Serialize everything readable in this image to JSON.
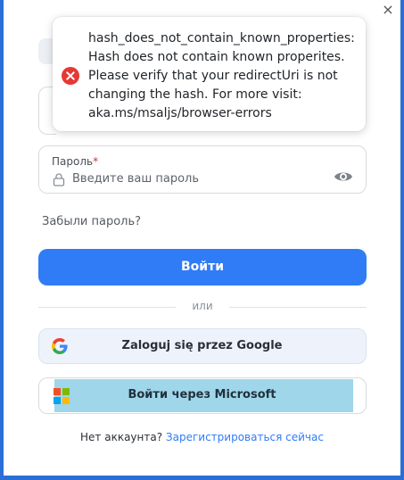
{
  "dialog": {
    "close_glyph": "×"
  },
  "toast": {
    "type": "error",
    "icon": "error-circle-icon",
    "message": "hash_does_not_contain_known_properties: Hash does not contain known properites. Please verify that your redirectUri is not changing the hash. For more visit: aka.ms/msaljs/browser-errors"
  },
  "password": {
    "label": "Пароль",
    "required_mark": "*",
    "placeholder": "Введите ваш пароль",
    "value": ""
  },
  "forgot_password": "Забыли пароль?",
  "login_button": "Войти",
  "divider": "или",
  "google_button": "Zaloguj się przez Google",
  "microsoft_button": "Войти через Microsoft",
  "signup": {
    "prompt": "Нет аккаунта?",
    "link": "Зарегистрироваться сейчас"
  },
  "colors": {
    "primary": "#2f7cf6",
    "error": "#e53935",
    "highlight": "#9fd6ea"
  }
}
